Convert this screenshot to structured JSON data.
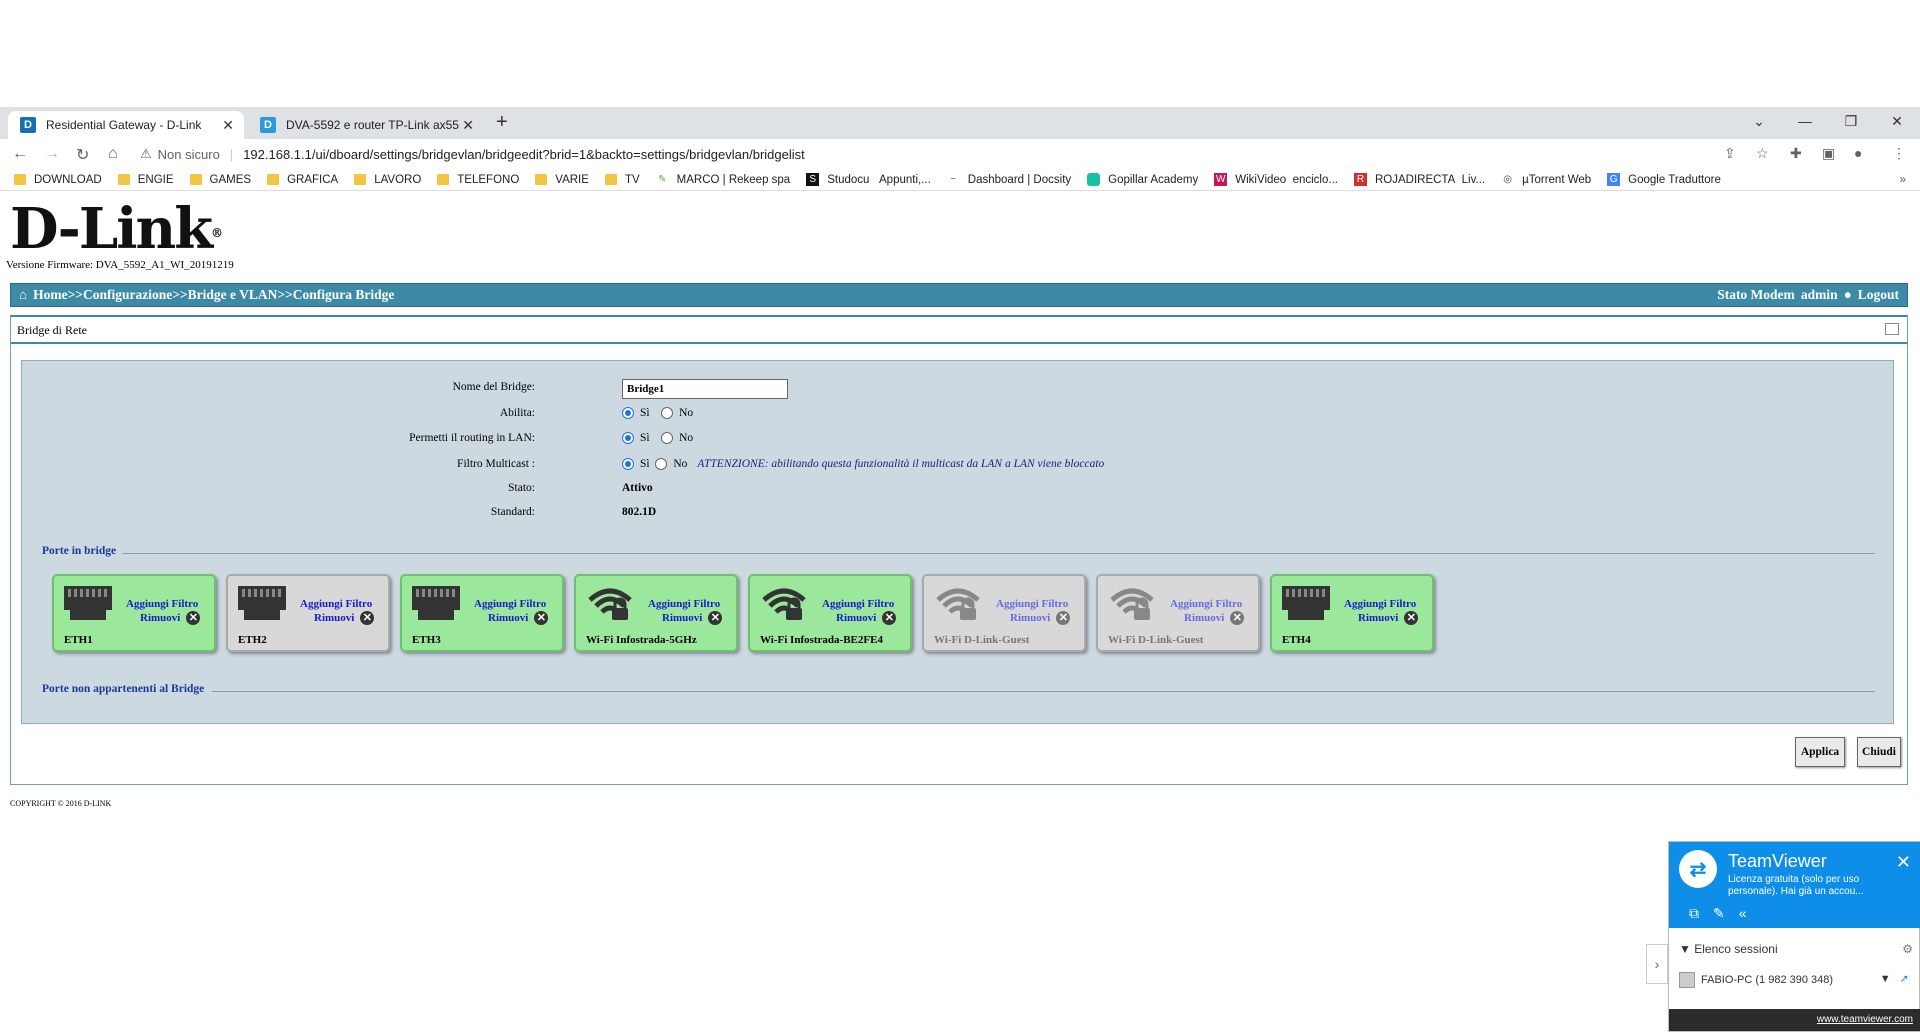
{
  "browser": {
    "tabs": [
      {
        "title": "Residential Gateway - D-Link",
        "favicon": "D"
      },
      {
        "title": "DVA-5592 e router TP-Link ax55",
        "favicon": "D"
      }
    ],
    "security_label": "Non sicuro",
    "url": "192.168.1.1/ui/dboard/settings/bridgevlan/bridgeedit?brid=1&backto=settings/bridgevlan/bridgelist",
    "bookmarks": [
      "DOWNLOAD",
      "ENGIE",
      "GAMES",
      "GRAFICA",
      "LAVORO",
      "TELEFONO",
      "VARIE",
      "TV",
      "MARCO | Rekeep spa",
      "Studocu",
      "Appunti,...",
      "Dashboard | Docsity",
      "Gopillar Academy",
      "WikiVideo",
      "enciclo...",
      "ROJADIRECTA",
      "Liv...",
      "µTorrent Web",
      "Google Traduttore"
    ]
  },
  "header": {
    "logo": "D-Link",
    "firmware": "Versione Firmware: DVA_5592_A1_WI_20191219",
    "breadcrumb": "Home>>Configurazione>>Bridge e VLAN>>Configura Bridge",
    "stato_modem": "Stato Modem",
    "user": "admin",
    "logout": "Logout"
  },
  "panel": {
    "title": "Bridge di Rete",
    "fields": {
      "nome_label": "Nome del Bridge:",
      "nome_value": "Bridge1",
      "abilita_label": "Abilita:",
      "routing_label": "Permetti il routing in LAN:",
      "filtro_label": "Filtro Multicast :",
      "si": "Sì",
      "no": "No",
      "attenzione": "ATTENZIONE: abilitando questa funzionalità il multicast da LAN a LAN viene bloccato",
      "stato_label": "Stato:",
      "stato_value": "Attivo",
      "standard_label": "Standard:",
      "standard_value": "802.1D"
    },
    "porte_in_bridge": "Porte in bridge",
    "porte_non": "Porte non appartenenti al Bridge",
    "add_filter": "Aggiungi Filtro",
    "remove": "Rimuovi",
    "ports": [
      {
        "name": "ETH1",
        "type": "eth",
        "enabled": true
      },
      {
        "name": "ETH2",
        "type": "eth",
        "enabled": false
      },
      {
        "name": "ETH3",
        "type": "eth",
        "enabled": true
      },
      {
        "name": "Wi-Fi Infostrada-5GHz",
        "type": "wifi",
        "enabled": true
      },
      {
        "name": "Wi-Fi Infostrada-BE2FE4",
        "type": "wifi",
        "enabled": true
      },
      {
        "name": "Wi-Fi D-Link-Guest",
        "type": "wifi",
        "enabled": false
      },
      {
        "name": "Wi-Fi D-Link-Guest",
        "type": "wifi",
        "enabled": false
      },
      {
        "name": "ETH4",
        "type": "eth",
        "enabled": true
      }
    ],
    "apply": "Applica",
    "close": "Chiudi"
  },
  "footer": {
    "copyright": "COPYRIGHT © 2016 D-LINK"
  },
  "teamviewer": {
    "name": "TeamViewer",
    "subtitle": "Licenza gratuita (solo per uso personale). Hai già un accou...",
    "sessions": "Elenco sessioni",
    "pc": "FABIO-PC (1 982 390 348)",
    "link": "www.teamviewer.com"
  }
}
